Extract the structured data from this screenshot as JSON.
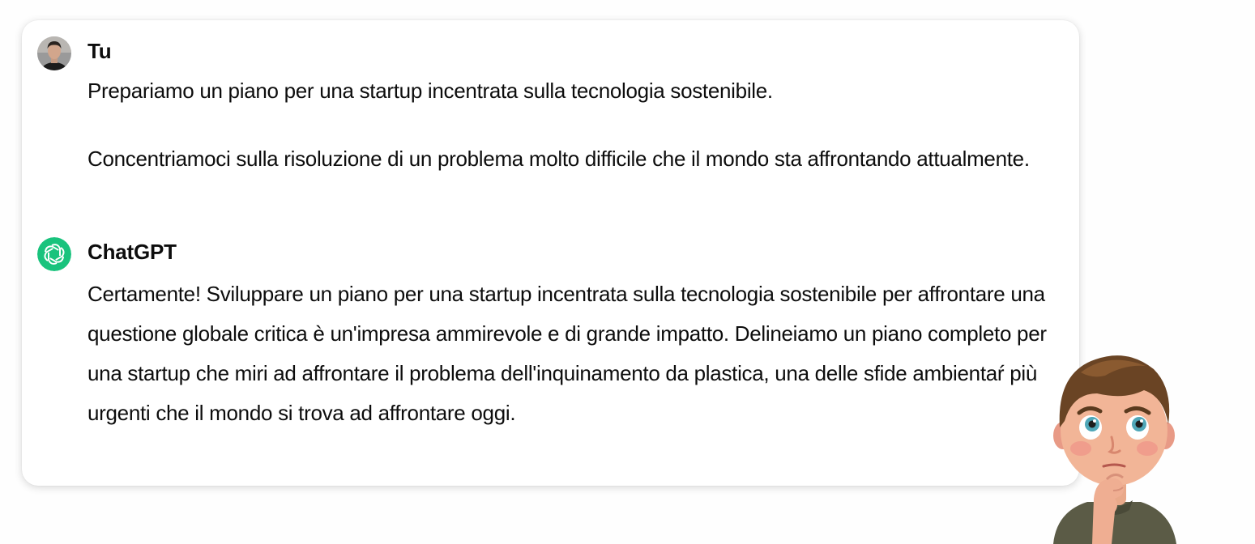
{
  "conversation": {
    "messages": [
      {
        "author": "Tu",
        "avatar_icon": "user-photo-avatar",
        "paragraphs": [
          "Prepariamo un piano per una startup incentrata sulla tecnologia sostenibile.",
          "Concentriamoci sulla risoluzione di un problema molto difficile che il mondo sta affrontando attualmente."
        ]
      },
      {
        "author": "ChatGPT",
        "avatar_icon": "openai-logo-icon",
        "avatar_color": "#19c37d",
        "paragraphs": [
          "Certamente! Sviluppare un piano per una startup incentrata sulla tecnologia sostenibile per affrontare una questione globale critica è un'impresa ammirevole e di grande impatto. Delineiamo un piano completo per una startup che miri ad affrontare il problema dell'inquinamento da plastica, una delle sfide ambientaŕ più urgenti che il mondo si trova ad affrontare oggi."
        ]
      }
    ]
  },
  "illustration": {
    "icon": "thinking-cartoon-boy-icon"
  }
}
